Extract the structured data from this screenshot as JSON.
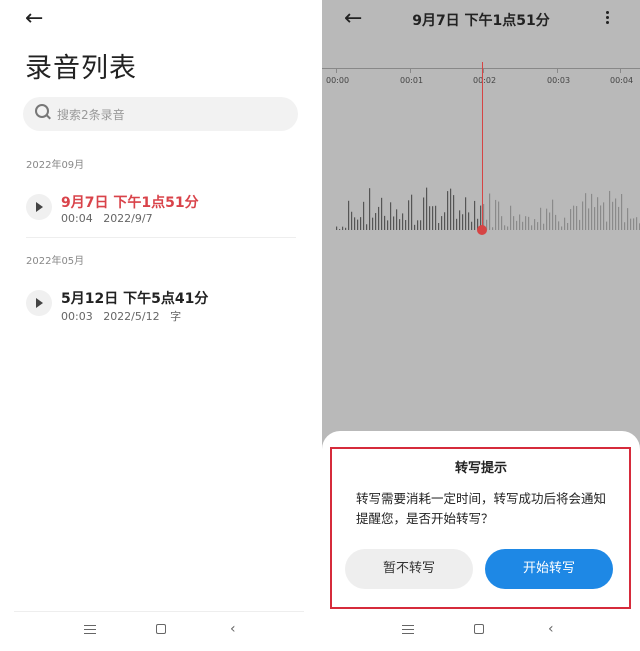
{
  "list_screen": {
    "title": "录音列表",
    "search_placeholder": "搜索2条录音",
    "groups": [
      {
        "label": "2022年09月",
        "recordings": [
          {
            "title": "9月7日 下午1点51分",
            "meta": "00:04   2022/9/7",
            "active": true,
            "title_color": "#d9434a"
          }
        ]
      },
      {
        "label": "2022年05月",
        "recordings": [
          {
            "title": "5月12日 下午5点41分",
            "meta": "00:03   2022/5/12   字",
            "active": false,
            "title_color": "#222222"
          }
        ]
      }
    ]
  },
  "detail_screen": {
    "title": "9月7日 下午1点51分",
    "timeline_ticks": [
      "00:00",
      "00:01",
      "00:02",
      "00:03",
      "00:04"
    ],
    "dialog": {
      "title": "转写提示",
      "message": "转写需要消耗一定时间，转写成功后将会通知提醒您，是否开始转写？",
      "cancel_label": "暂不转写",
      "confirm_label": "开始转写",
      "accent_color": "#1e88e5",
      "highlight_color": "#d62b3b"
    }
  }
}
